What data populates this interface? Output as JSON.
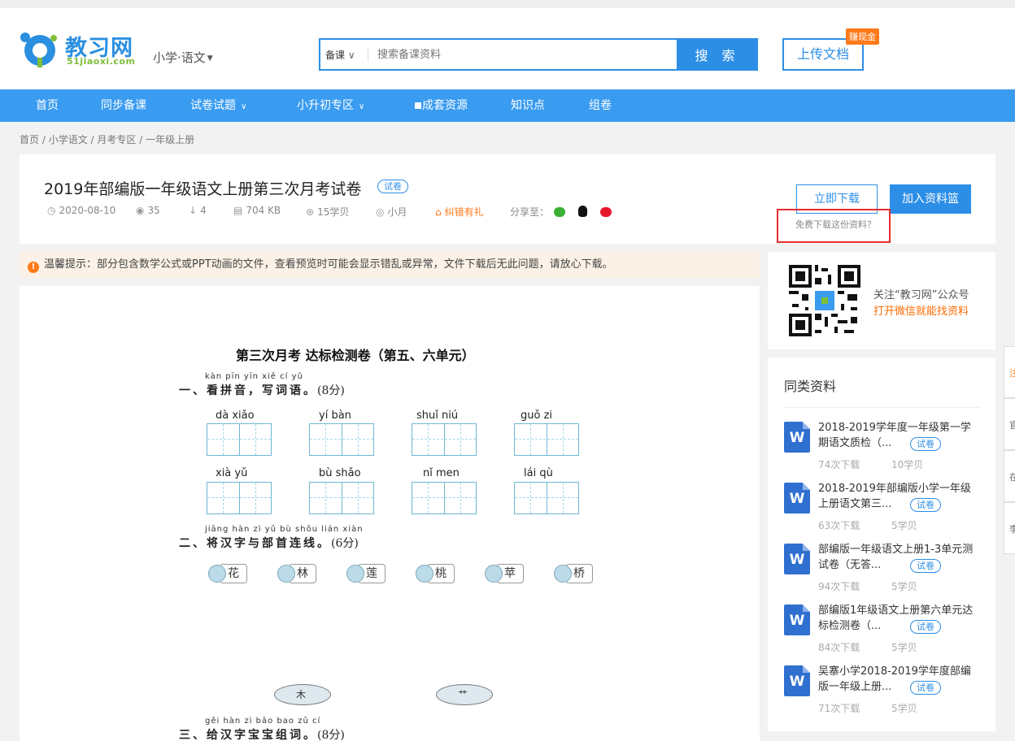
{
  "header": {
    "logo_text": "教习网",
    "logo_sub": "51jiaoxi.com",
    "grade_selector": "小学·语文",
    "search_type": "备课",
    "search_placeholder": "搜索备课资料",
    "search_button": "搜 索",
    "upload_button": "上传文档",
    "earn_badge": "赚现金"
  },
  "nav": {
    "items": [
      "首页",
      "同步备课",
      "试卷试题",
      "小升初专区",
      "成套资源",
      "知识点",
      "组卷"
    ]
  },
  "breadcrumb": [
    "首页",
    "小学语文",
    "月考专区",
    "一年级上册"
  ],
  "document": {
    "title": "2019年部编版一年级语文上册第三次月考试卷",
    "tag": "试卷",
    "date": "2020-08-10",
    "views": "35",
    "downloads": "4",
    "size": "704 KB",
    "cost": "15学贝",
    "author": "小月",
    "error_report": "纠错有礼",
    "share_label": "分享至：",
    "download_button": "立即下载",
    "basket_button": "加入资料篮",
    "free_download": "免费下载这份资料？"
  },
  "tip": {
    "label": "温馨提示：",
    "text": "部分包含数学公式或PPT动画的文件，查看预览时可能会显示错乱或异常，文件下载后无此问题，请放心下载。"
  },
  "paper": {
    "title": "第三次月考 达标检测卷（第五、六单元）",
    "q1_pinyin": "kàn pīn yīn    xiě  cí  yǔ",
    "q1_text": "一、看拼音，写词语。",
    "q1_score": "(8分)",
    "pinyin_row1": [
      "dà    xiǎo",
      "yí     bàn",
      "shuǐ    niú",
      "guǒ     zi"
    ],
    "pinyin_row2": [
      "xià    yǔ",
      "bù   shǎo",
      "nǐ    men",
      "lái     qù"
    ],
    "q2_pinyin": "jiāng hàn  zì   yǔ   bù  shǒu lián xiàn",
    "q2_text": "二、将汉字与部首连线。",
    "q2_score": "(6分)",
    "frogs": [
      "花",
      "林",
      "莲",
      "桃",
      "苹",
      "桥"
    ],
    "lilies": [
      "木",
      "艹"
    ],
    "q3_pinyin": "gěi hàn  zì  bǎo bao  zǔ    cí",
    "q3_text": "三、给汉字宝宝组词。",
    "q3_score": "(8分)"
  },
  "qr": {
    "line1": "关注“教习网”公众号",
    "line2": "打开微信就能找资料"
  },
  "related": {
    "title": "同类资料",
    "items": [
      {
        "title": "2018-2019学年度一年级第一学期语文质检（...",
        "tag": "试卷",
        "downloads": "74次下载",
        "cost": "10学贝"
      },
      {
        "title": "2018-2019年部编版小学一年级上册语文第三...",
        "tag": "试卷",
        "downloads": "63次下载",
        "cost": "5学贝"
      },
      {
        "title": "部编版一年级语文上册1-3单元测试卷（无答...",
        "tag": "试卷",
        "downloads": "94次下载",
        "cost": "5学贝"
      },
      {
        "title": "部编版1年级语文上册第六单元达标检测卷（...",
        "tag": "试卷",
        "downloads": "84次下载",
        "cost": "5学贝"
      },
      {
        "title": "吴寨小学2018-2019学年度部编版一年级上册...",
        "tag": "试卷",
        "downloads": "71次下载",
        "cost": "5学贝"
      }
    ]
  },
  "right_tabs": [
    "注",
    "官",
    "在",
    "李"
  ],
  "colors": {
    "primary": "#2d8ee6",
    "nav": "#3a9cf0",
    "accent_orange": "#ff7a1a",
    "highlight_red": "#e52d2d"
  }
}
